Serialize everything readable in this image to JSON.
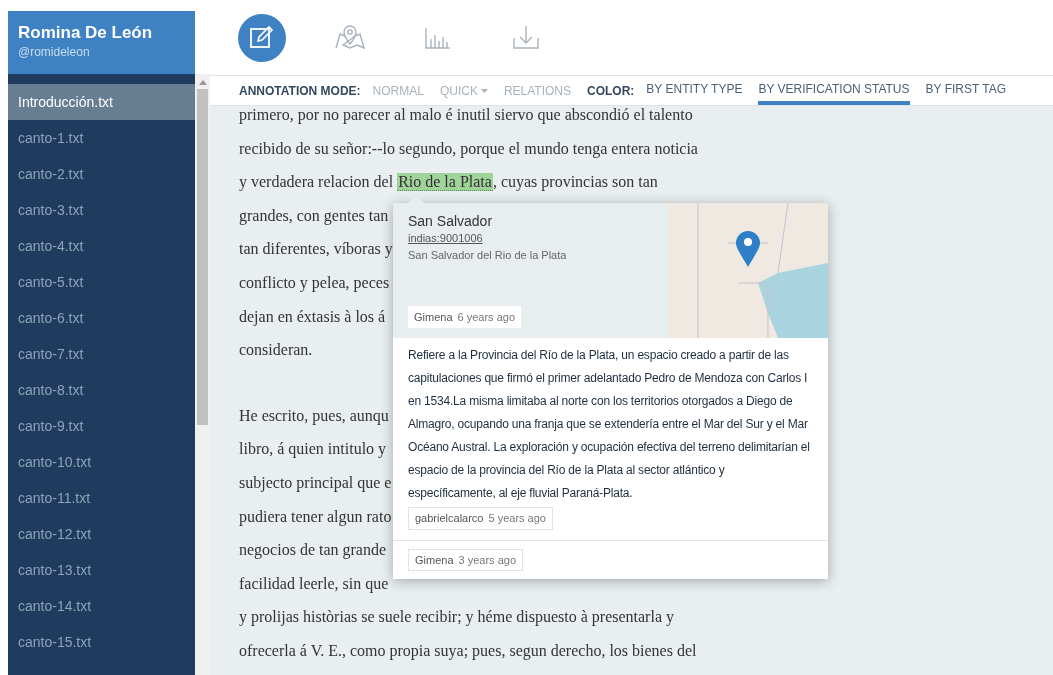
{
  "user": {
    "name": "Romina De León",
    "handle": "@romideleon"
  },
  "files": [
    {
      "label": "Introducción.txt",
      "selected": true
    },
    {
      "label": "canto-1.txt",
      "selected": false
    },
    {
      "label": "canto-2.txt",
      "selected": false
    },
    {
      "label": "canto-3.txt",
      "selected": false
    },
    {
      "label": "canto-4.txt",
      "selected": false
    },
    {
      "label": "canto-5.txt",
      "selected": false
    },
    {
      "label": "canto-6.txt",
      "selected": false
    },
    {
      "label": "canto-7.txt",
      "selected": false
    },
    {
      "label": "canto-8.txt",
      "selected": false
    },
    {
      "label": "canto-9.txt",
      "selected": false
    },
    {
      "label": "canto-10.txt",
      "selected": false
    },
    {
      "label": "canto-11.txt",
      "selected": false
    },
    {
      "label": "canto-12.txt",
      "selected": false
    },
    {
      "label": "canto-13.txt",
      "selected": false
    },
    {
      "label": "canto-14.txt",
      "selected": false
    },
    {
      "label": "canto-15.txt",
      "selected": false
    }
  ],
  "tools": [
    {
      "kind": "edit",
      "selected": true
    },
    {
      "kind": "map",
      "selected": false
    },
    {
      "kind": "chart",
      "selected": false
    },
    {
      "kind": "download",
      "selected": false
    }
  ],
  "annotation_mode": {
    "label": "ANNOTATION MODE:",
    "options": [
      {
        "label": "NORMAL",
        "disabled": true,
        "dropdown": false
      },
      {
        "label": "QUICK",
        "disabled": true,
        "dropdown": true
      },
      {
        "label": "RELATIONS",
        "disabled": true,
        "dropdown": false
      }
    ]
  },
  "color_mode": {
    "label": "COLOR:",
    "options": [
      {
        "label": "BY ENTITY TYPE",
        "selected": false
      },
      {
        "label": "BY VERIFICATION STATUS",
        "selected": true
      },
      {
        "label": "BY FIRST TAG",
        "selected": false
      }
    ]
  },
  "document": {
    "paragraphs": [
      [
        [
          {
            "text": "primero, por no parecer al malo é inutil siervo que abscondió el talento"
          }
        ],
        [
          {
            "text": "recibido de su señor:--lo segundo, porque el mundo tenga entera noticia"
          }
        ],
        [
          {
            "text": "y verdadera relacion del "
          },
          {
            "text": "Rio de la Plata",
            "annotated": true
          },
          {
            "text": ", cuyas provincias son tan"
          }
        ],
        [
          {
            "text": "grandes, con gentes tan"
          }
        ],
        [
          {
            "text": "tan diferentes, víboras y"
          }
        ],
        [
          {
            "text": "conflicto y pelea, peces"
          }
        ],
        [
          {
            "text": "dejan en éxtasis à los á"
          }
        ],
        [
          {
            "text": "consideran."
          }
        ]
      ],
      [
        [
          {
            "text": "He escrito, pues, aunqu"
          }
        ],
        [
          {
            "text": "libro, á quien intitulo y"
          }
        ],
        [
          {
            "text": "subjecto principal que e"
          }
        ],
        [
          {
            "text": "pudiera tener algun rato"
          }
        ],
        [
          {
            "text": "negocios de tan grande"
          }
        ],
        [
          {
            "text": "facilidad leerle, sin que"
          }
        ],
        [
          {
            "text": "y prolijas històrias se suele recibir; y héme dispuesto à presentarla y"
          }
        ],
        [
          {
            "text": "ofrecerla á V. E., como propia suya; pues, segun derecho, los bienes del"
          }
        ]
      ]
    ]
  },
  "popup": {
    "place": {
      "name": "San Salvador",
      "id": "indias:9001006",
      "full_name": "San Salvador del Rio de la Plata"
    },
    "place_author": {
      "user": "Gimena",
      "time": "6 years ago"
    },
    "comments": [
      {
        "text": "Refiere a la Provincia del Río de la Plata, un espacio creado a partir de las capitulaciones que firmó el primer adelantado Pedro de Mendoza con Carlos I en 1534.La misma limitaba al norte con los territorios otorgados a Diego de Almagro, ocupando una franja que se extendería entre el Mar del Sur y el Mar Océano Austral. La exploración y ocupación efectiva del terreno delimitarían el espacio de la provincia del Río de la Plata al sector atlántico y específicamente, al eje fluvial Paraná-Plata.",
        "user": "gabrielcalarco",
        "time": "5 years ago"
      }
    ],
    "footer_author": {
      "user": "Gimena",
      "time": "3 years ago"
    }
  }
}
